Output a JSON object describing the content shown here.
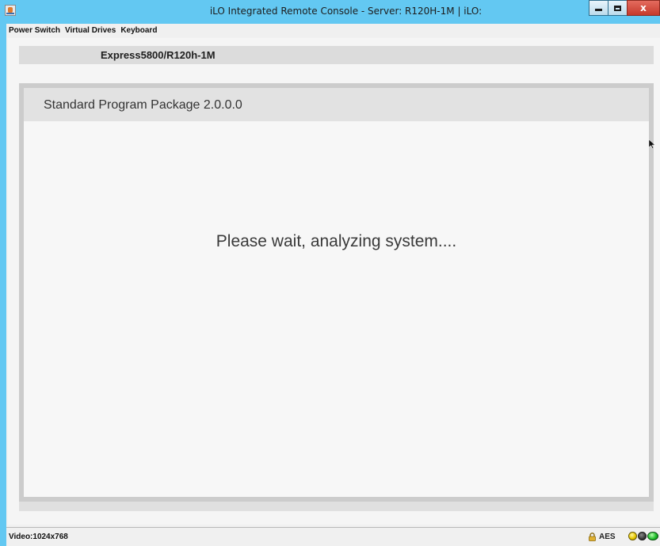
{
  "window": {
    "title": "iLO Integrated Remote Console - Server: R120H-1M | iLO:",
    "icon": "java-app-icon",
    "controls": {
      "minimize": "minimize-icon",
      "maximize": "maximize-icon",
      "close": "x"
    },
    "frame_color": "#63c8f2"
  },
  "menubar": {
    "items": [
      {
        "label": "Power Switch"
      },
      {
        "label": "Virtual Drives"
      },
      {
        "label": "Keyboard"
      }
    ]
  },
  "screen": {
    "model": "Express5800/R120h-1M",
    "panel_title": "Standard Program Package 2.0.0.0",
    "message": "Please wait, analyzing system...."
  },
  "statusbar": {
    "video": "Video:1024x768",
    "encryption": "AES",
    "lock_icon": "lock-icon",
    "indicators": [
      {
        "name": "yellow-indicator",
        "color": "#e8c900"
      },
      {
        "name": "gray-indicator",
        "color": "#3a3a3a"
      },
      {
        "name": "green-indicator",
        "color": "#1fbf2a"
      }
    ]
  }
}
